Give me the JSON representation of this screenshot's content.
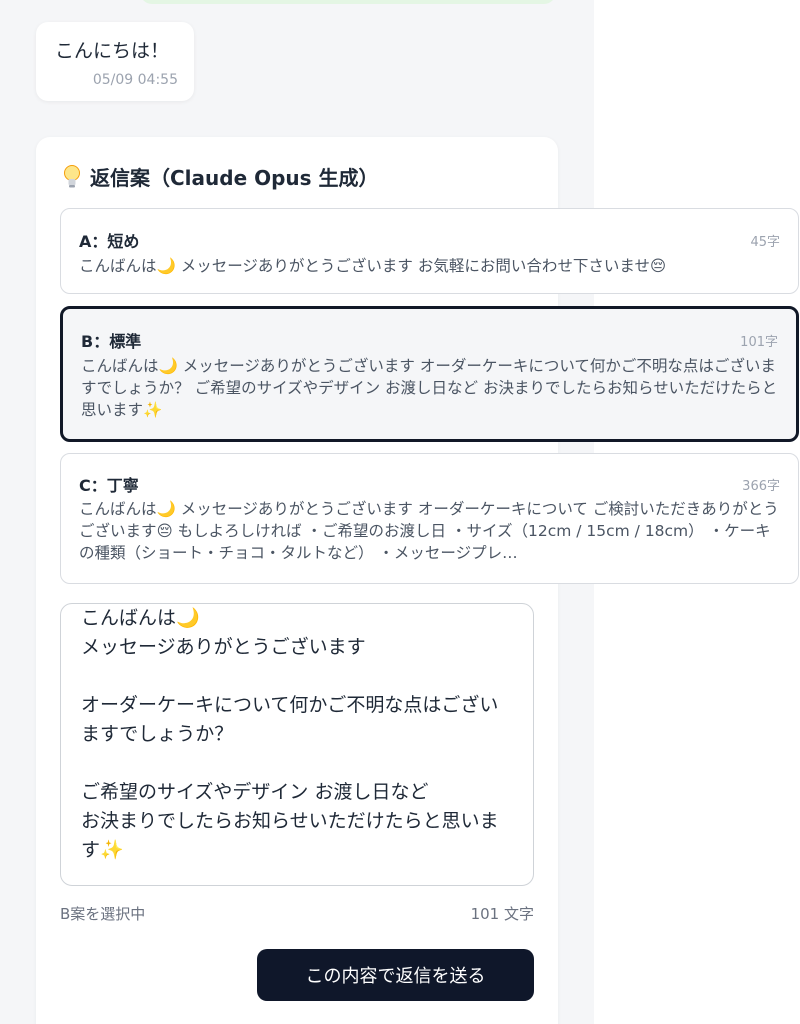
{
  "chat": {
    "message_text": "こんにちは！",
    "message_time": "05/09 04:55"
  },
  "reply_panel": {
    "icon": "lightbulb-icon",
    "title": "返信案（Claude Opus 生成）",
    "options": [
      {
        "label": "A：短め",
        "count": "45字",
        "text": "こんばんは🌙 メッセージありがとうございます お気軽にお問い合わせ下さいませ😔"
      },
      {
        "label": "B：標準",
        "count": "101字",
        "text": "こんばんは🌙 メッセージありがとうございます オーダーケーキについて何かご不明な点はございますでしょうか？ ご希望のサイズやデザイン お渡し日など お決まりでしたらお知らせいただけたらと思います✨"
      },
      {
        "label": "C：丁寧",
        "count": "366字",
        "text": "こんばんは🌙 メッセージありがとうございます オーダーケーキについて ご検討いただきありがとうございます😔 もしよろしければ ・ご希望のお渡し日 ・サイズ（12cm / 15cm / 18cm） ・ケーキの種類（ショート・チョコ・タルトなど） ・メッセージプレ…"
      }
    ],
    "selected_index": 1,
    "editor_text": "こんばんは🌙\nメッセージありがとうございます\n\nオーダーケーキについて何かご不明な点はございますでしょうか？\n\nご希望のサイズやデザイン お渡し日など\nお決まりでしたらお知らせいただけたらと思います✨",
    "status_selected": "B案を選択中",
    "status_count": "101 文字",
    "send_label": "この内容で返信を送る"
  },
  "colors": {
    "send_button_bg": "#0f172a",
    "selected_border": "#111827",
    "chat_bg": "#f5f6f8"
  }
}
